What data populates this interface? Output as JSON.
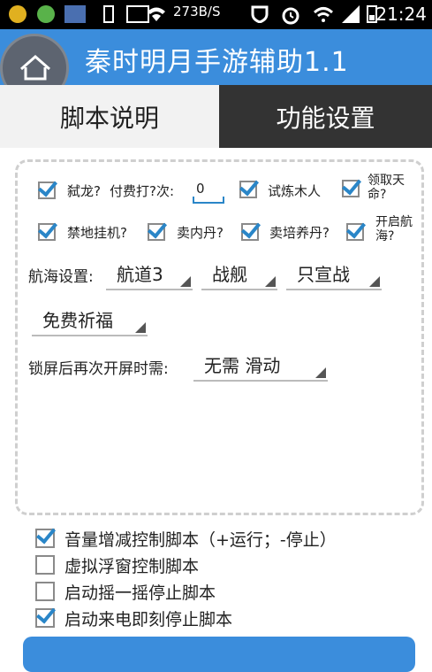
{
  "statusbar": {
    "speed": "273B/S",
    "time": "21:24"
  },
  "app": {
    "title": "秦时明月手游辅助1.1"
  },
  "tabs": [
    {
      "label": "脚本说明",
      "active": false
    },
    {
      "label": "功能设置",
      "active": true
    }
  ],
  "options": {
    "dragon": {
      "label": "弑龙?",
      "checked": true
    },
    "paid_label": "付费打?次:",
    "paid_value": "0",
    "wood": {
      "label": "试炼木人",
      "checked": true
    },
    "fate": {
      "label": "领取天命?",
      "checked": true
    },
    "forbidden": {
      "label": "禁地挂机?",
      "checked": true
    },
    "sell_inner": {
      "label": "卖内丹?",
      "checked": true
    },
    "sell_nurture": {
      "label": "卖培养丹?",
      "checked": true
    },
    "voyage_open": {
      "label": "开启航海?",
      "checked": true
    }
  },
  "voyage": {
    "label": "航海设置:",
    "route": "航道3",
    "ship": "战舰",
    "mode": "只宣战",
    "blessing": "免费祈福"
  },
  "lock": {
    "label": "锁屏后再次开屏时需:",
    "value": "无需 滑动"
  },
  "controls": [
    {
      "label": "音量增减控制脚本（+运行；-停止）",
      "checked": true
    },
    {
      "label": "虚拟浮窗控制脚本",
      "checked": false
    },
    {
      "label": "启动摇一摇停止脚本",
      "checked": false
    },
    {
      "label": "启动来电即刻停止脚本",
      "checked": true
    }
  ],
  "colors": {
    "accent": "#3b8ddc",
    "tab_active_bg": "#333333",
    "check": "#2a86c8"
  }
}
